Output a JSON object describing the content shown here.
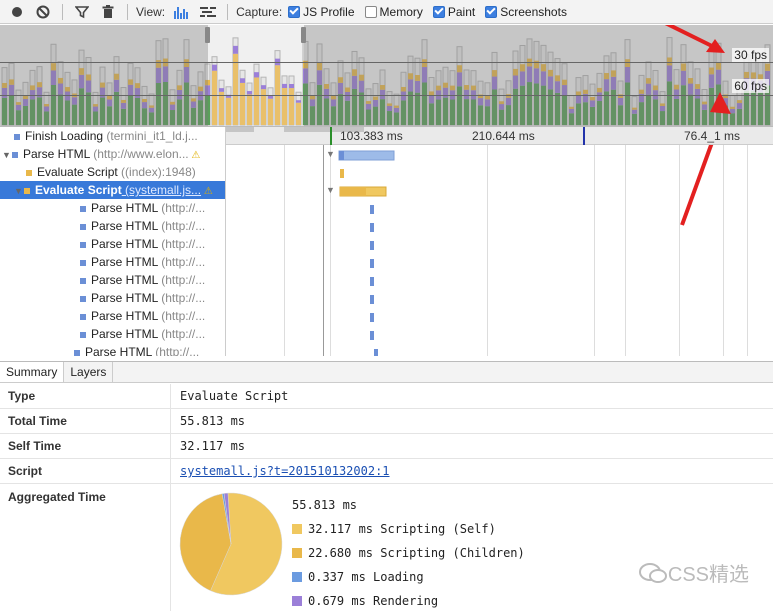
{
  "toolbar": {
    "view_label": "View:",
    "capture_label": "Capture:",
    "checks": [
      {
        "label": "JS Profile",
        "checked": true
      },
      {
        "label": "Memory",
        "checked": false
      },
      {
        "label": "Paint",
        "checked": true
      },
      {
        "label": "Screenshots",
        "checked": true
      }
    ]
  },
  "overview": {
    "fps30_label": "30 fps",
    "fps60_label": "60 fps"
  },
  "ruler": {
    "ticks": [
      "103.383 ms",
      "210.644 ms",
      "76.4_1 ms"
    ]
  },
  "tree": {
    "rows": [
      {
        "name": "Finish Loading",
        "sub": " (termini_it1_ld.j...",
        "color": "#6b8fd6",
        "sel": false
      },
      {
        "name": "Parse HTML",
        "sub": " (http://www.elon...",
        "color": "#6b8fd6",
        "sel": false,
        "warn": true,
        "tri": true
      },
      {
        "name": "Evaluate Script",
        "sub": " ((index):1948)",
        "color": "#e9b84a",
        "sel": false
      },
      {
        "name": "Evaluate Script",
        "sub": " (systemall.js...",
        "color": "#e9b84a",
        "sel": true,
        "warn": true,
        "tri": true
      },
      {
        "name": "Parse HTML",
        "sub": " (http://...",
        "color": "#6b8fd6",
        "sel": false
      },
      {
        "name": "Parse HTML",
        "sub": " (http://...",
        "color": "#6b8fd6",
        "sel": false
      },
      {
        "name": "Parse HTML",
        "sub": " (http://...",
        "color": "#6b8fd6",
        "sel": false
      },
      {
        "name": "Parse HTML",
        "sub": " (http://...",
        "color": "#6b8fd6",
        "sel": false
      },
      {
        "name": "Parse HTML",
        "sub": " (http://...",
        "color": "#6b8fd6",
        "sel": false
      },
      {
        "name": "Parse HTML",
        "sub": " (http://...",
        "color": "#6b8fd6",
        "sel": false
      },
      {
        "name": "Parse HTML",
        "sub": " (http://...",
        "color": "#6b8fd6",
        "sel": false
      },
      {
        "name": "Parse HTML",
        "sub": " (http://...",
        "color": "#6b8fd6",
        "sel": false
      },
      {
        "name": "Parse HTML",
        "sub": " (http://...",
        "color": "#6b8fd6",
        "sel": false
      }
    ]
  },
  "tabs": [
    "Summary",
    "Layers"
  ],
  "summary": {
    "type_label": "Type",
    "type_value": "Evaluate Script",
    "total_label": "Total Time",
    "total_value": "55.813 ms",
    "self_label": "Self Time",
    "self_value": "32.117 ms",
    "script_label": "Script",
    "script_value": "systemall.js?t=201510132002:1",
    "agg_label": "Aggregated Time",
    "agg_total": "55.813 ms",
    "legend": [
      {
        "text": "32.117 ms Scripting (Self)",
        "color": "#f0c860"
      },
      {
        "text": "22.680 ms Scripting (Children)",
        "color": "#e9b84a"
      },
      {
        "text": "0.337 ms Loading",
        "color": "#6b9be0"
      },
      {
        "text": "0.679 ms Rendering",
        "color": "#9b7fd8"
      }
    ]
  },
  "watermark": "CSS精选",
  "colors": {
    "scripting": "#e9b84a",
    "loading": "#6b8fd6",
    "painting": "#5aa05a",
    "rendering": "#9b7fd8",
    "selection": "#3879d9"
  }
}
